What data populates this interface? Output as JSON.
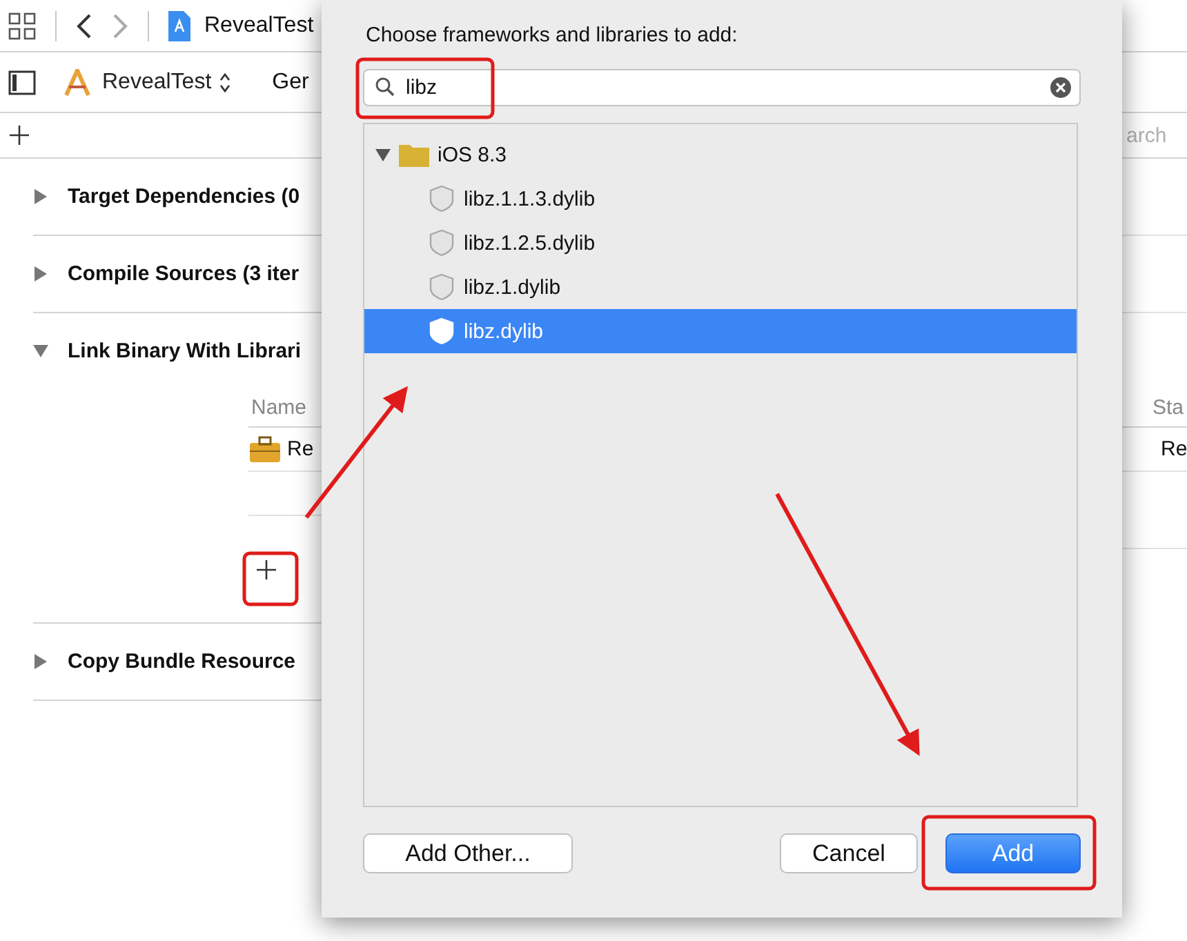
{
  "toolbar": {
    "project": "RevealTest"
  },
  "target_bar": {
    "target": "RevealTest",
    "tab": "Ger"
  },
  "search": {
    "placeholder": "arch"
  },
  "sections": [
    {
      "title": "Target Dependencies (0",
      "expanded": false
    },
    {
      "title": "Compile Sources (3 iter",
      "expanded": false
    },
    {
      "title": "Link Binary With Librari",
      "expanded": true,
      "table": {
        "columns": [
          "Name",
          "Sta"
        ],
        "rows": [
          [
            "Re",
            "Re"
          ]
        ]
      }
    },
    {
      "title": "Copy Bundle Resource",
      "expanded": false
    }
  ],
  "dialog": {
    "title": "Choose frameworks and libraries to add:",
    "search": {
      "value": "libz"
    },
    "tree": [
      {
        "label": "iOS 8.3",
        "expanded": true,
        "children": [
          {
            "label": "libz.1.1.3.dylib",
            "selected": false
          },
          {
            "label": "libz.1.2.5.dylib",
            "selected": false
          },
          {
            "label": "libz.1.dylib",
            "selected": false
          },
          {
            "label": "libz.dylib",
            "selected": true
          }
        ]
      }
    ],
    "buttons": [
      {
        "label": "Add Other...",
        "kind": "default"
      },
      {
        "label": "Cancel",
        "kind": "default"
      },
      {
        "label": "Add",
        "kind": "primary"
      }
    ]
  }
}
